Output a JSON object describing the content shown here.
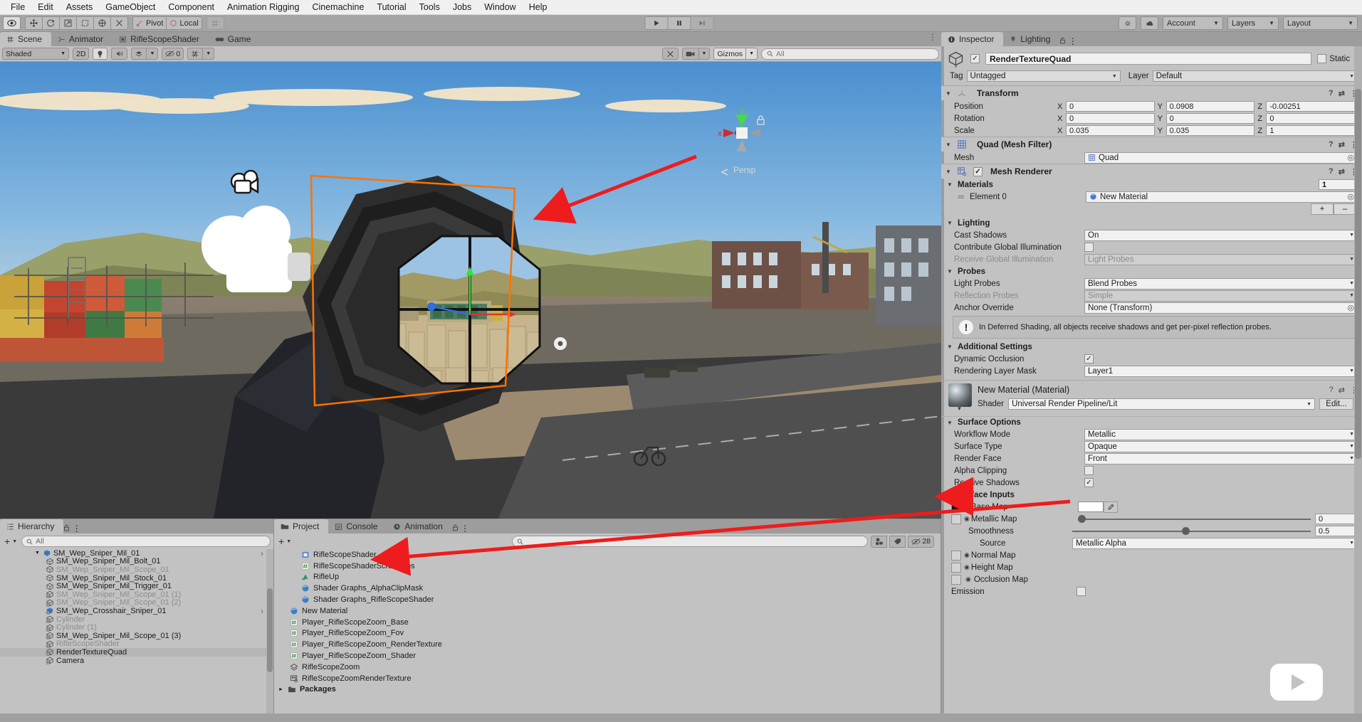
{
  "menubar": {
    "items": [
      "File",
      "Edit",
      "Assets",
      "GameObject",
      "Component",
      "Animation Rigging",
      "Cinemachine",
      "Tutorial",
      "Tools",
      "Jobs",
      "Window",
      "Help"
    ]
  },
  "toolbar": {
    "tools": [
      "hand-icon",
      "move-icon",
      "rotate-icon",
      "scale-icon",
      "rect-icon",
      "transform-icon",
      "custom-icon"
    ],
    "pivot_label": "Pivot",
    "local_label": "Local",
    "grid_label": "grid-snap-icon",
    "play_label": "play-icon",
    "pause_label": "pause-icon",
    "step_label": "step-icon",
    "collab_label": "collab-icon",
    "cloud_label": "cloud-icon",
    "account_label": "Account",
    "layers_label": "Layers",
    "layout_label": "Layout"
  },
  "scene": {
    "tabs": [
      {
        "label": "Scene",
        "icon": "grid-icon",
        "active": true
      },
      {
        "label": "Animator",
        "icon": "animator-icon",
        "active": false
      },
      {
        "label": "RifleScopeShader",
        "icon": "shader-icon",
        "active": false
      },
      {
        "label": "Game",
        "icon": "gamepad-icon",
        "active": false
      }
    ],
    "toolbar": {
      "draw_mode": "Shaded",
      "mode_2d": "2D",
      "lighting": "lighting-icon",
      "audio": "audio-icon",
      "fx": "fx-icon",
      "hidden_count": "0",
      "grid": "grid-visibility-icon",
      "tools": "scene-tools-icon",
      "camera": "scene-camera-icon",
      "gizmos_label": "Gizmos",
      "search_placeholder": "All"
    },
    "gizmo": {
      "x": "x",
      "y": "y",
      "persp": "Persp"
    },
    "selection_outline_color": "#ff7200"
  },
  "hierarchy": {
    "tab_label": "Hierarchy",
    "search_placeholder": "All",
    "items": [
      {
        "label": "SM_Wep_Sniper_Mil_01",
        "indent": 3,
        "icon": "prefab-icon",
        "faded": false,
        "selected": false,
        "expand": "down",
        "chevron": true
      },
      {
        "label": "SM_Wep_Sniper_Mil_Bolt_01",
        "indent": 4,
        "icon": "mesh-icon",
        "faded": false,
        "selected": false
      },
      {
        "label": "SM_Wep_Sniper_Mil_Scope_01",
        "indent": 4,
        "icon": "mesh-icon",
        "faded": true,
        "selected": false
      },
      {
        "label": "SM_Wep_Sniper_Mil_Stock_01",
        "indent": 4,
        "icon": "mesh-icon",
        "faded": false,
        "selected": false
      },
      {
        "label": "SM_Wep_Sniper_Mil_Trigger_01",
        "indent": 4,
        "icon": "mesh-icon",
        "faded": false,
        "selected": false
      },
      {
        "label": "SM_Wep_Sniper_Mil_Scope_01 (1)",
        "indent": 4,
        "icon": "mesh-add-icon",
        "faded": true,
        "selected": false
      },
      {
        "label": "SM_Wep_Sniper_Mil_Scope_01 (2)",
        "indent": 4,
        "icon": "mesh-add-icon",
        "faded": true,
        "selected": false
      },
      {
        "label": "SM_Wep_Crosshair_Sniper_01",
        "indent": 4,
        "icon": "prefab-add-icon",
        "faded": false,
        "selected": false,
        "chevron": true
      },
      {
        "label": "Cylinder",
        "indent": 4,
        "icon": "mesh-add-icon",
        "faded": true,
        "selected": false
      },
      {
        "label": "Cylinder (1)",
        "indent": 4,
        "icon": "mesh-add-icon",
        "faded": true,
        "selected": false
      },
      {
        "label": "SM_Wep_Sniper_Mil_Scope_01 (3)",
        "indent": 4,
        "icon": "mesh-add-icon",
        "faded": false,
        "selected": false
      },
      {
        "label": "RifleScopeShader",
        "indent": 4,
        "icon": "mesh-add-icon",
        "faded": true,
        "selected": false
      },
      {
        "label": "RenderTextureQuad",
        "indent": 4,
        "icon": "mesh-add-icon",
        "faded": false,
        "selected": true
      },
      {
        "label": "Camera",
        "indent": 4,
        "icon": "mesh-add-icon",
        "faded": false,
        "selected": false
      }
    ]
  },
  "project": {
    "tabs": [
      {
        "label": "Project",
        "icon": "folder-icon",
        "active": true
      },
      {
        "label": "Console",
        "icon": "console-icon",
        "active": false
      },
      {
        "label": "Animation",
        "icon": "clock-icon",
        "active": false
      }
    ],
    "search_placeholder": "",
    "hidden_count": "28",
    "items": [
      {
        "label": "RifleScopeShader",
        "indent": 2,
        "icon": "shader-asset-icon"
      },
      {
        "label": "RifleScopeShaderScreenPos",
        "indent": 2,
        "icon": "script-icon"
      },
      {
        "label": "RifleUp",
        "indent": 2,
        "icon": "anim-icon"
      },
      {
        "label": "Shader Graphs_AlphaClipMask",
        "indent": 2,
        "icon": "material-icon"
      },
      {
        "label": "Shader Graphs_RifleScopeShader",
        "indent": 2,
        "icon": "material-icon"
      },
      {
        "label": "New Material",
        "indent": 1,
        "icon": "material-icon"
      },
      {
        "label": "Player_RifleScopeZoom_Base",
        "indent": 1,
        "icon": "script-icon"
      },
      {
        "label": "Player_RifleScopeZoom_Fov",
        "indent": 1,
        "icon": "script-icon"
      },
      {
        "label": "Player_RifleScopeZoom_RenderTexture",
        "indent": 1,
        "icon": "script-icon"
      },
      {
        "label": "Player_RifleScopeZoom_Shader",
        "indent": 1,
        "icon": "script-icon"
      },
      {
        "label": "RifleScopeZoom",
        "indent": 1,
        "icon": "scene-asset-icon"
      },
      {
        "label": "RifleScopeZoomRenderTexture",
        "indent": 1,
        "icon": "rendertexture-icon"
      },
      {
        "label": "Packages",
        "indent": 0,
        "icon": "folder-icon",
        "bold": true,
        "expand": "right"
      }
    ]
  },
  "inspector": {
    "tabs": [
      {
        "label": "Inspector",
        "icon": "info-icon",
        "active": true
      },
      {
        "label": "Lighting",
        "icon": "bulb-icon",
        "active": false
      }
    ],
    "object": {
      "enabled": true,
      "name": "RenderTextureQuad",
      "static_label": "Static",
      "static_checked": false,
      "tag_label": "Tag",
      "tag_value": "Untagged",
      "layer_label": "Layer",
      "layer_value": "Default"
    },
    "transform": {
      "title": "Transform",
      "rows": [
        {
          "label": "Position",
          "x": "0",
          "y": "0.0908",
          "z": "-0.00251"
        },
        {
          "label": "Rotation",
          "x": "0",
          "y": "0",
          "z": "0"
        },
        {
          "label": "Scale",
          "x": "0.035",
          "y": "0.035",
          "z": "1"
        }
      ]
    },
    "mesh_filter": {
      "title": "Quad (Mesh Filter)",
      "mesh_label": "Mesh",
      "mesh_value": "Quad"
    },
    "mesh_renderer": {
      "title": "Mesh Renderer",
      "enabled": true,
      "materials_title": "Materials",
      "materials_count": "1",
      "element_label": "Element 0",
      "element_value": "New Material",
      "add_label": "+",
      "remove_label": "–",
      "lighting_title": "Lighting",
      "cast_shadows_label": "Cast Shadows",
      "cast_shadows_value": "On",
      "contribute_gi_label": "Contribute Global Illumination",
      "contribute_gi_checked": false,
      "receive_gi_label": "Receive Global Illumination",
      "receive_gi_value": "Light Probes",
      "probes_title": "Probes",
      "light_probes_label": "Light Probes",
      "light_probes_value": "Blend Probes",
      "reflection_probes_label": "Reflection Probes",
      "reflection_probes_value": "Simple",
      "anchor_override_label": "Anchor Override",
      "anchor_override_value": "None (Transform)",
      "helpbox": "In Deferred Shading, all objects receive shadows and get per-pixel reflection probes.",
      "additional_title": "Additional Settings",
      "dynamic_occlusion_label": "Dynamic Occlusion",
      "dynamic_occlusion_checked": true,
      "rendering_layer_mask_label": "Rendering Layer Mask",
      "rendering_layer_mask_value": "Layer1"
    },
    "material": {
      "title": "New Material (Material)",
      "shader_label": "Shader",
      "shader_value": "Universal Render Pipeline/Lit",
      "edit_label": "Edit...",
      "surface_options_title": "Surface Options",
      "workflow_mode_label": "Workflow Mode",
      "workflow_mode_value": "Metallic",
      "surface_type_label": "Surface Type",
      "surface_type_value": "Opaque",
      "render_face_label": "Render Face",
      "render_face_value": "Front",
      "alpha_clipping_label": "Alpha Clipping",
      "alpha_clipping_checked": false,
      "receive_shadows_label": "Receive Shadows",
      "receive_shadows_checked": true,
      "surface_inputs_title": "Surface Inputs",
      "base_map_label": "Base Map",
      "base_map_color": "#ffffff",
      "metallic_map_label": "Metallic Map",
      "metallic_value": "0",
      "smoothness_label": "Smoothness",
      "smoothness_value": "0.5",
      "source_label": "Source",
      "source_value": "Metallic Alpha",
      "normal_map_label": "Normal Map",
      "height_map_label": "Height Map",
      "occlusion_map_label": "Occlusion Map",
      "emission_label": "Emission"
    }
  },
  "annotations": {
    "arrow_color": "#ee1c1c",
    "arrows": [
      {
        "name": "arrow-to-quad-in-scene"
      },
      {
        "name": "arrow-to-rendertexture-asset"
      },
      {
        "name": "arrow-to-base-map"
      }
    ]
  }
}
